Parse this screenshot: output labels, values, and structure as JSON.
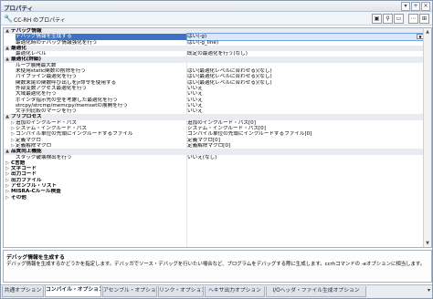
{
  "window": {
    "title": "プロパティ",
    "buttons": [
      "▾",
      "+",
      "×"
    ]
  },
  "toolbar": {
    "title": "CC-RH のプロパティ",
    "icon": "wrench-icon",
    "buttons": [
      "▣",
      "⚲",
      "▭",
      "⋯",
      "⊞"
    ]
  },
  "grid": {
    "rows": [
      {
        "kind": "cat",
        "exp": "▲",
        "indent": 0,
        "name": "デバッグ情報",
        "value": ""
      },
      {
        "kind": "item",
        "indent": 1,
        "name": "デバッグ情報を生成する",
        "value": "はい(-g)",
        "selected": true
      },
      {
        "kind": "item",
        "indent": 1,
        "name": "最適化時のデバッグ情報強化を行う",
        "value": "はい(-g_line)"
      },
      {
        "kind": "cat",
        "exp": "▲",
        "indent": 0,
        "name": "最適化",
        "value": ""
      },
      {
        "kind": "item",
        "indent": 1,
        "name": "最適化レベル",
        "value": "既定の最適化を行う(なし)"
      },
      {
        "kind": "cat",
        "exp": "▲",
        "indent": 0,
        "name": "最適化(詳細)",
        "value": ""
      },
      {
        "kind": "item",
        "indent": 1,
        "name": "ループ展開最大数",
        "value": ""
      },
      {
        "kind": "item",
        "indent": 1,
        "name": "未使用static関数の削除を行う",
        "value": "はい(最適化レベルに合わせる)(なし)"
      },
      {
        "kind": "item",
        "indent": 1,
        "name": "パイプライン最適化を行う",
        "value": "はい(最適化レベルに合わせる)(なし)"
      },
      {
        "kind": "item",
        "indent": 1,
        "name": "関数末尾の関数呼び出しをjr命令を使用する",
        "value": "はい(最適化レベルに合わせる)(なし)"
      },
      {
        "kind": "item",
        "indent": 1,
        "name": "外部変数アクセス最適化を行う",
        "value": "いいえ"
      },
      {
        "kind": "item",
        "indent": 1,
        "name": "大域最適化を行う",
        "value": "いいえ"
      },
      {
        "kind": "item",
        "indent": 1,
        "name": "ポインタ指示先の型を考慮した最適化を行う",
        "value": "いいえ"
      },
      {
        "kind": "item",
        "indent": 1,
        "name": "strcpy/strcmp/memcpy/memsetの展開を行う",
        "value": "いいえ"
      },
      {
        "kind": "item",
        "indent": 1,
        "name": "文字列比較のマージを行う",
        "value": "いいえ"
      },
      {
        "kind": "cat",
        "exp": "▲",
        "indent": 0,
        "name": "プリプロセス",
        "value": ""
      },
      {
        "kind": "item",
        "exp": "▷",
        "indent": 1,
        "name": "追加のインクルード・パス",
        "value": "追加のインクルード・パス[0]"
      },
      {
        "kind": "item",
        "exp": "▷",
        "indent": 1,
        "name": "システム・インクルード・パス",
        "value": "システム・インクルード・パス[0]"
      },
      {
        "kind": "item",
        "exp": "▷",
        "indent": 1,
        "name": "コンパイル単位の先頭にインクルードするファイル",
        "value": "コンパイル単位の先頭にインクルードするファイル[0]"
      },
      {
        "kind": "item",
        "exp": "▷",
        "indent": 1,
        "name": "定義マクロ",
        "value": "定義マクロ[0]"
      },
      {
        "kind": "item",
        "exp": "▷",
        "indent": 1,
        "name": "定義解除マクロ",
        "value": "定義解除マクロ[0]"
      },
      {
        "kind": "cat",
        "exp": "▲",
        "indent": 0,
        "name": "品質向上機能",
        "value": ""
      },
      {
        "kind": "item",
        "indent": 1,
        "name": "スタック破壊検出を行う",
        "value": "いいえ(なし)"
      },
      {
        "kind": "sub",
        "exp": "▷",
        "indent": 0,
        "name": "C言語",
        "value": ""
      },
      {
        "kind": "sub",
        "exp": "▷",
        "indent": 0,
        "name": "文字コード",
        "value": ""
      },
      {
        "kind": "sub",
        "exp": "▷",
        "indent": 0,
        "name": "出力コード",
        "value": ""
      },
      {
        "kind": "sub",
        "exp": "▷",
        "indent": 0,
        "name": "出力ファイル",
        "value": ""
      },
      {
        "kind": "sub",
        "exp": "▷",
        "indent": 0,
        "name": "アセンブル・リスト",
        "value": ""
      },
      {
        "kind": "sub",
        "exp": "▷",
        "indent": 0,
        "name": "MISRA-Cルール検査",
        "value": ""
      },
      {
        "kind": "sub",
        "exp": "▷",
        "indent": 0,
        "name": "その他",
        "value": ""
      }
    ]
  },
  "description": {
    "title": "デバッグ情報を生成する",
    "text": "デバッグ情報を生成するかどうかを指定します。デバッガでソース・デバッグを行いたい場合など、プログラムをデバッグする際に生成します。ccrhコマンドの -eオプションに相当します。"
  },
  "tabs": [
    {
      "label": "共通オプション",
      "active": false
    },
    {
      "label": "コンパイル・オプション",
      "active": true
    },
    {
      "label": "アセンブル・オプション",
      "active": false
    },
    {
      "label": "リンク・オプション",
      "active": false
    },
    {
      "label": "ヘキサ出力オプション",
      "active": false
    },
    {
      "label": "I/Oヘッダ・ファイル生成オプション",
      "active": false
    }
  ],
  "tabs_more": "▾"
}
